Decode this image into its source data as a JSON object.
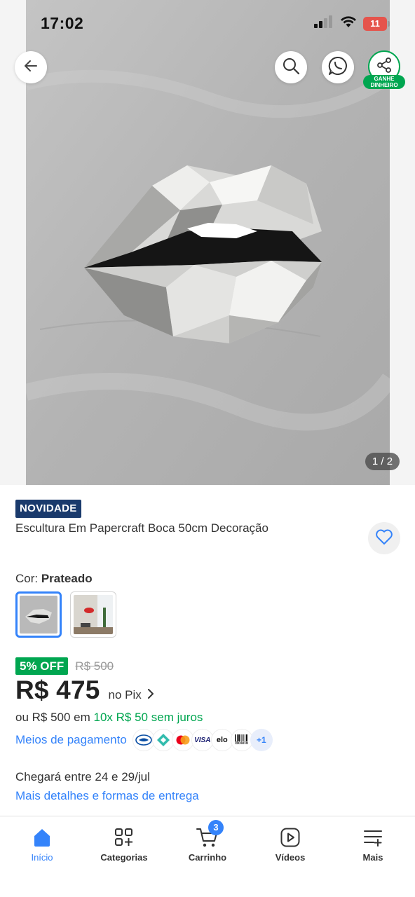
{
  "status_bar": {
    "time": "17:02",
    "battery": "11"
  },
  "gallery": {
    "counter": "1 / 2"
  },
  "share": {
    "tag_line1": "GANHE",
    "tag_line2": "DINHEIRO"
  },
  "product": {
    "badge": "NOVIDADE",
    "title": "Escultura Em Papercraft Boca 50cm Decoração",
    "color_label": "Cor: ",
    "color_value": "Prateado",
    "discount": "5% OFF",
    "old_price": "R$ 500",
    "price": "R$ 475",
    "price_method": "no Pix",
    "installments_prefix": "ou R$ 500 em ",
    "installments_highlight": "10x R$ 50 sem juros",
    "payment_link": "Meios de pagamento",
    "payment_more": "+1",
    "payment_methods": [
      "mercado-pago-icon",
      "pix-icon",
      "mastercard-icon",
      "visa-icon",
      "elo-icon",
      "boleto-icon"
    ],
    "visa_text": "VISA",
    "elo_text": "elo",
    "boleto_text": "Boleto",
    "delivery": "Chegará entre 24 e 29/jul",
    "delivery_link": "Mais detalhes e formas de entrega"
  },
  "bottom_nav": {
    "items": [
      {
        "label": "Início",
        "icon": "home-icon",
        "active": true
      },
      {
        "label": "Categorias",
        "icon": "categories-icon",
        "active": false
      },
      {
        "label": "Carrinho",
        "icon": "cart-icon",
        "active": false,
        "badge": "3"
      },
      {
        "label": "Vídeos",
        "icon": "video-icon",
        "active": false
      },
      {
        "label": "Mais",
        "icon": "more-icon",
        "active": false
      }
    ]
  },
  "colors": {
    "accent": "#3483fa",
    "green": "#00a650",
    "badge_navy": "#1a3a6c"
  }
}
